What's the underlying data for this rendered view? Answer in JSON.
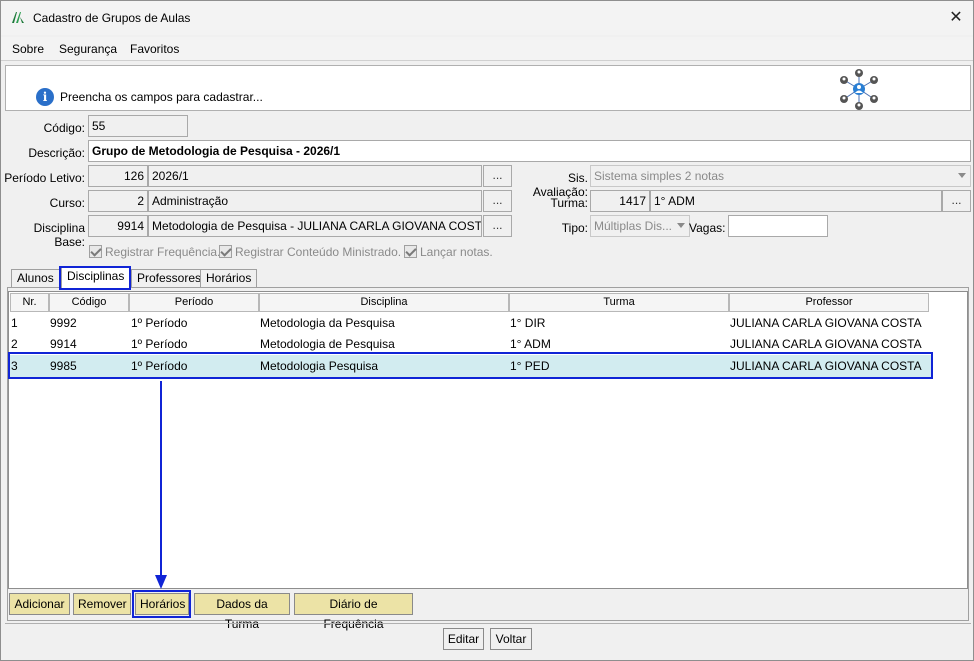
{
  "window": {
    "title": "Cadastro de Grupos de Aulas",
    "close_glyph": "✕"
  },
  "menu": {
    "sobre": "Sobre",
    "seguranca": "Segurança",
    "favoritos": "Favoritos"
  },
  "header": {
    "info_text": "Preencha os campos para cadastrar...",
    "info_icon": "info-icon",
    "network_icon": "network-users-icon"
  },
  "form": {
    "codigo_label": "Código:",
    "codigo_value": "55",
    "descricao_label": "Descrição:",
    "descricao_value": "Grupo de Metodologia de Pesquisa - 2026/1",
    "periodo_label": "Período Letivo:",
    "periodo_code": "126",
    "periodo_value": "2026/1",
    "curso_label": "Curso:",
    "curso_code": "2",
    "curso_value": "Administração",
    "disciplina_label": "Disciplina Base:",
    "disciplina_code": "9914",
    "disciplina_value": "Metodologia de Pesquisa - JULIANA CARLA GIOVANA COSTA",
    "lookup_button": "...",
    "sis_avaliacao_label": "Sis. Avaliação:",
    "sis_avaliacao_value": "Sistema simples 2 notas",
    "turma_label": "Turma:",
    "turma_code": "1417",
    "turma_value": "1° ADM",
    "tipo_label": "Tipo:",
    "tipo_value": "Múltiplas Dis...",
    "vagas_label": "Vagas:",
    "vagas_value": "",
    "chk_frequencia": "Registrar Frequência.",
    "chk_conteudo": "Registrar Conteúdo Ministrado.",
    "chk_notas": "Lançar notas."
  },
  "tabs": {
    "alunos": "Alunos",
    "disciplinas": "Disciplinas",
    "professores": "Professores",
    "horarios": "Horários"
  },
  "grid": {
    "columns": {
      "nr": "Nr.",
      "codigo": "Código",
      "periodo": "Período",
      "disciplina": "Disciplina",
      "turma": "Turma",
      "professor": "Professor"
    },
    "rows": [
      {
        "nr": "1",
        "codigo": "9992",
        "periodo": "1º Período",
        "disciplina": "Metodologia da Pesquisa",
        "turma": "1° DIR",
        "professor": "JULIANA CARLA GIOVANA COSTA"
      },
      {
        "nr": "2",
        "codigo": "9914",
        "periodo": "1º Período",
        "disciplina": "Metodologia de Pesquisa",
        "turma": "1° ADM",
        "professor": "JULIANA CARLA GIOVANA COSTA"
      },
      {
        "nr": "3",
        "codigo": "9985",
        "periodo": "1º Período",
        "disciplina": "Metodologia Pesquisa",
        "turma": "1° PED",
        "professor": "JULIANA CARLA GIOVANA COSTA"
      }
    ]
  },
  "actions": {
    "adicionar": "Adicionar",
    "remover": "Remover",
    "horarios": "Horários",
    "dados_turma": "Dados da Turma",
    "diario": "Diário de Frequência"
  },
  "footer": {
    "editar": "Editar",
    "voltar": "Voltar"
  },
  "colors": {
    "highlight": "#1024d6",
    "selected_row": "#d2ecf0",
    "action_button": "#ece3a6"
  }
}
